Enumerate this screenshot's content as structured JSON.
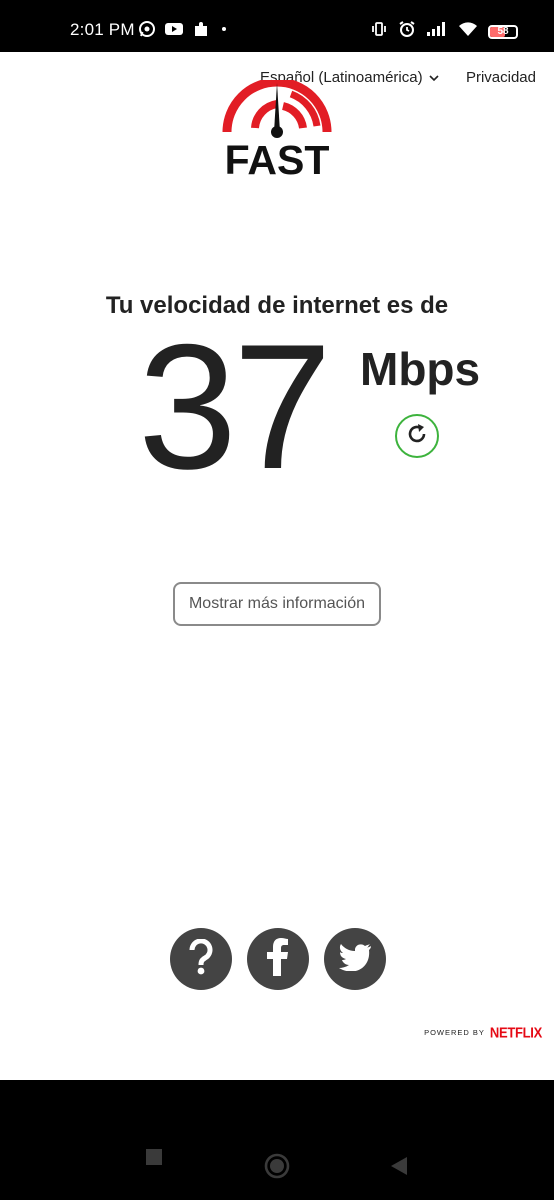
{
  "status_bar": {
    "time": "2:01 PM",
    "left_icons": [
      "whatsapp-icon",
      "youtube-icon",
      "puzzle-icon",
      "dot-icon"
    ],
    "right_icons": [
      "vibrate-icon",
      "alarm-icon",
      "signal-icon",
      "wifi-icon",
      "battery-icon"
    ],
    "battery_level": "58",
    "battery_color": "#ff6b6b"
  },
  "header": {
    "language": "Español (Latinoamérica)",
    "privacy": "Privacidad"
  },
  "logo": {
    "text": "FAST",
    "accent_color": "#e21d25"
  },
  "result": {
    "headline": "Tu velocidad de internet es de",
    "speed": "37",
    "unit": "Mbps",
    "refresh_color": "#3db33d"
  },
  "more_info_button": "Mostrar más información",
  "social": [
    "help-icon",
    "facebook-icon",
    "twitter-icon"
  ],
  "footer": {
    "powered_by": "POWERED BY",
    "brand": "NETFLIX",
    "brand_color": "#e50914"
  },
  "nav_bar": [
    "recents-icon",
    "home-icon",
    "back-icon"
  ]
}
